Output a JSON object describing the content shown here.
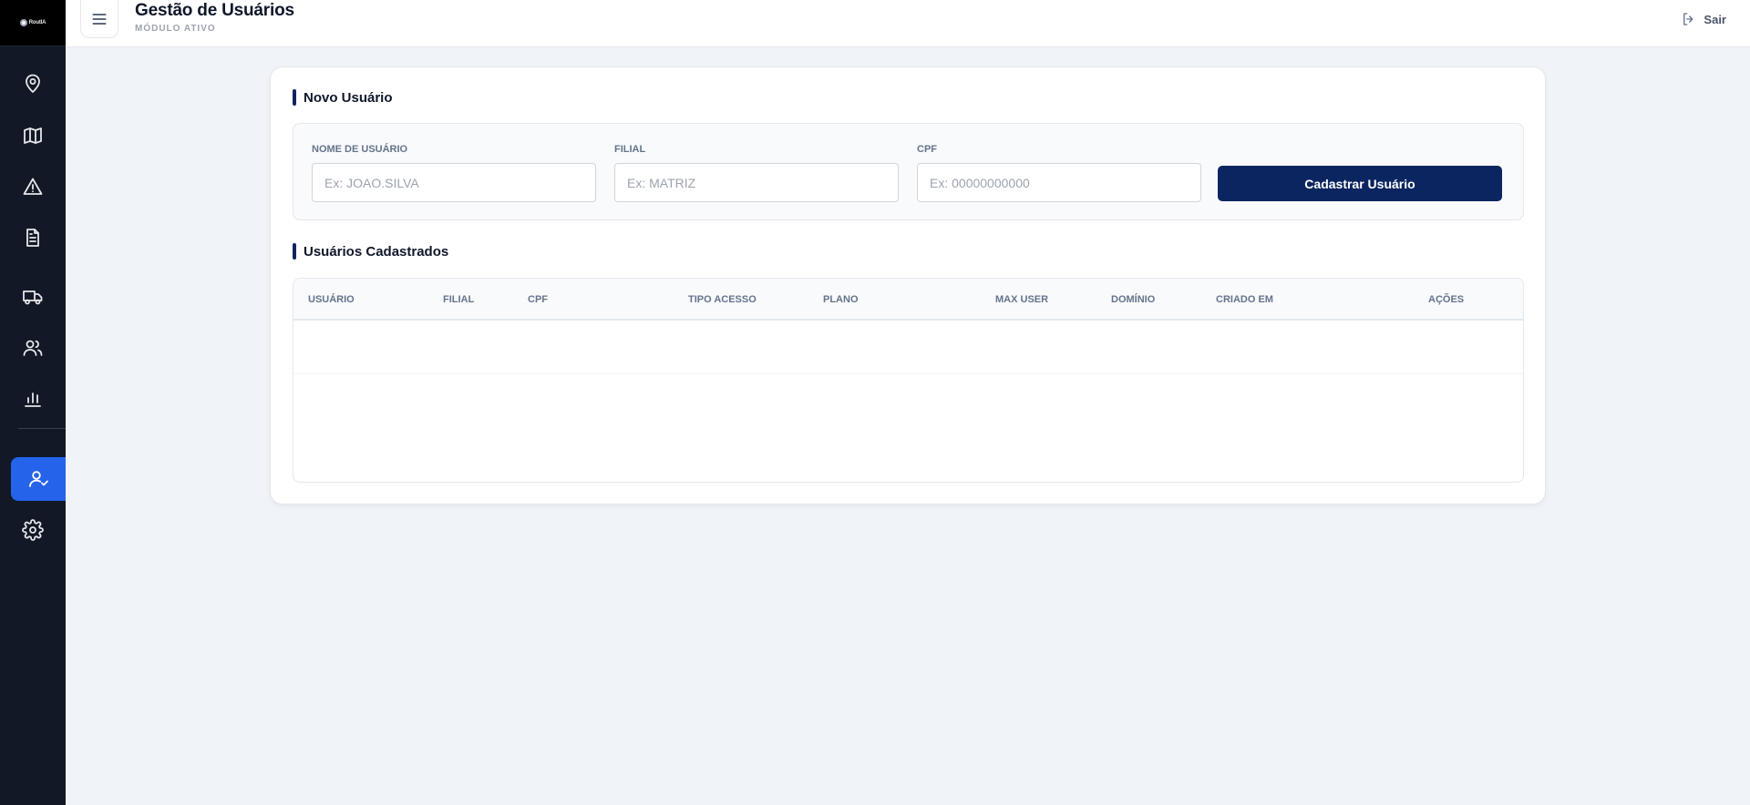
{
  "app": {
    "logo": "RoutIA"
  },
  "sidebar": {
    "items": [
      {
        "name": "map-pin-icon",
        "active": false
      },
      {
        "name": "map-icon",
        "active": false
      },
      {
        "name": "alert-triangle-icon",
        "active": false
      },
      {
        "name": "document-icon",
        "active": false
      },
      {
        "name": "truck-icon",
        "active": false
      },
      {
        "name": "users-icon",
        "active": false
      },
      {
        "name": "bar-chart-icon",
        "active": false
      },
      {
        "name": "user-check-icon",
        "active": true
      },
      {
        "name": "gear-icon",
        "active": false
      }
    ]
  },
  "header": {
    "title": "Gestão de Usuários",
    "subtitle": "MÓDULO ATIVO",
    "logout_label": "Sair"
  },
  "new_user": {
    "section_title": "Novo Usuário",
    "fields": {
      "username": {
        "label": "NOME DE USUÁRIO",
        "placeholder": "Ex: JOAO.SILVA",
        "value": ""
      },
      "branch": {
        "label": "FILIAL",
        "placeholder": "Ex: MATRIZ",
        "value": ""
      },
      "cpf": {
        "label": "CPF",
        "placeholder": "Ex: 00000000000",
        "value": ""
      }
    },
    "submit_label": "Cadastrar Usuário"
  },
  "users_table": {
    "section_title": "Usuários Cadastrados",
    "columns": [
      "USUÁRIO",
      "FILIAL",
      "CPF",
      "TIPO ACESSO",
      "PLANO",
      "MAX USER",
      "DOMÍNIO",
      "CRIADO EM",
      "AÇÕES"
    ],
    "rows": []
  },
  "colors": {
    "sidebar_bg": "#121826",
    "active_nav": "#2563eb",
    "primary": "#0b2560",
    "page_bg": "#f0f3f8"
  }
}
